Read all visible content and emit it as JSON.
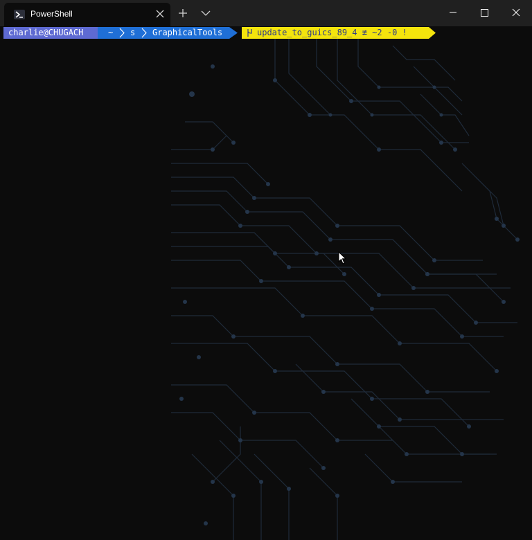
{
  "window": {
    "tab_title": "PowerShell",
    "tab_icon": "powershell-icon",
    "new_tab_icon": "plus-icon",
    "dropdown_icon": "chevron-down-icon",
    "minimize_icon": "minimize-icon",
    "maximize_icon": "maximize-icon",
    "close_icon": "close-icon"
  },
  "prompt": {
    "user_host": "charlie@CHUGACH",
    "home": "~",
    "dir1": "s",
    "dir2": "GraphicalTools",
    "git_status": "update_to_guics_89_4 ≢ ~2 -0 !",
    "colors": {
      "user_bg": "#5e6ad2",
      "dir_bg": "#1f6fd6",
      "git_bg": "#f4e40c",
      "git_fg": "#2e3a87"
    }
  },
  "background_image": "circuit-face-art"
}
